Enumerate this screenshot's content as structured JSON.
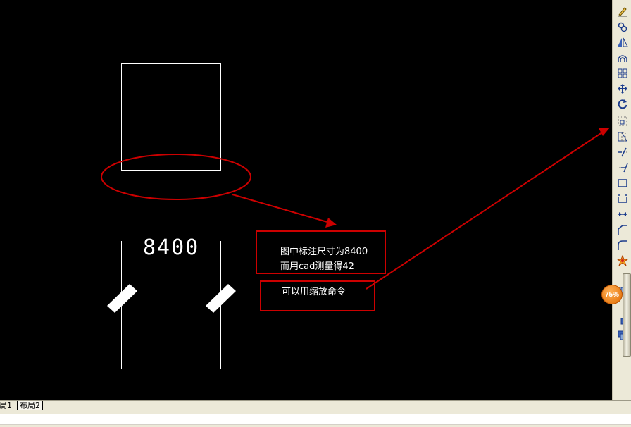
{
  "drawing": {
    "dimension_value": "8400",
    "annotation_box1": {
      "line1": "图中标注尺寸为8400",
      "line2": "而用cad测量得42"
    },
    "annotation_box2": {
      "line1": "可以用缩放命令"
    }
  },
  "colors": {
    "canvas_bg": "#000000",
    "drawing_lines": "#ffffff",
    "annotation_red": "#cc0000",
    "toolbar_bg": "#ece9d8"
  },
  "modify_toolbar": {
    "tools": [
      {
        "icon": "erase-icon"
      },
      {
        "icon": "copy-icon"
      },
      {
        "icon": "mirror-icon"
      },
      {
        "icon": "offset-icon"
      },
      {
        "icon": "array-icon"
      },
      {
        "icon": "move-icon"
      },
      {
        "icon": "rotate-icon"
      },
      {
        "icon": "scale-icon"
      },
      {
        "icon": "stretch-icon"
      },
      {
        "icon": "trim-icon"
      },
      {
        "icon": "extend-icon"
      },
      {
        "icon": "break-at-point-icon"
      },
      {
        "icon": "break-icon"
      },
      {
        "icon": "join-icon"
      },
      {
        "icon": "chamfer-icon"
      },
      {
        "icon": "fillet-icon"
      },
      {
        "icon": "explode-icon"
      }
    ]
  },
  "zoom_badge": "75%",
  "layout_tabs": [
    "局1",
    "布局2"
  ]
}
